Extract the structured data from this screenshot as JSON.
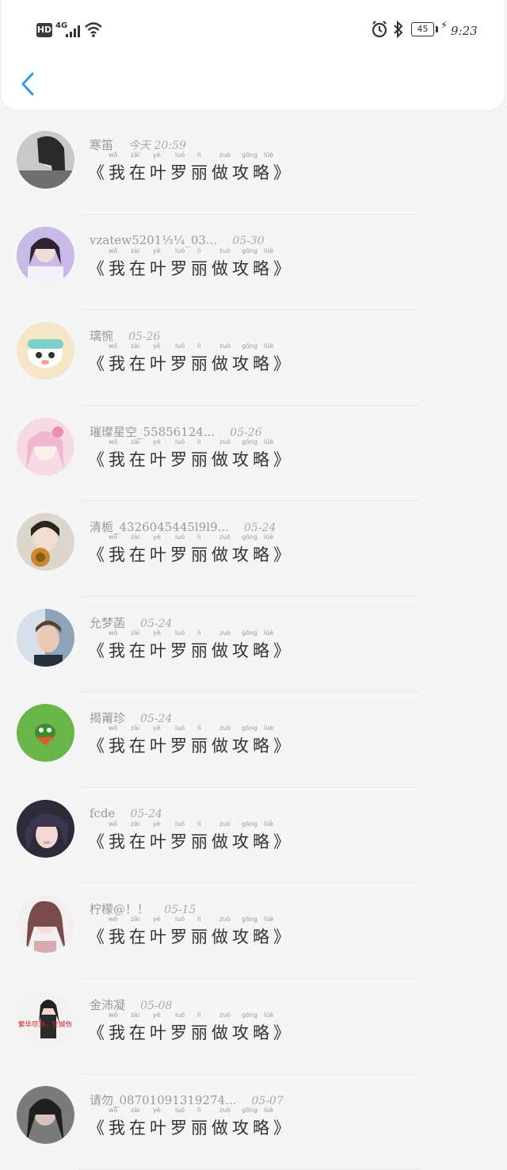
{
  "status_bar": {
    "hd": "HD",
    "network": "4G",
    "battery": "45",
    "time": "9:23",
    "icons": [
      "signal-icon",
      "wifi-icon",
      "alarm-icon",
      "bluetooth-icon",
      "battery-icon",
      "charging-icon"
    ]
  },
  "header": {
    "back_icon": "chevron-left-icon",
    "accent_color": "#2f9cf0"
  },
  "items": [
    {
      "name": "寒笛",
      "date": "今天 20:59",
      "title": "《我在叶罗丽做攻略》"
    },
    {
      "name": "vzatew5201⅓¼_03...",
      "date": "05-30",
      "title": "《我在叶罗丽做攻略》"
    },
    {
      "name": "璃惋",
      "date": "05-26",
      "title": "《我在叶罗丽做攻略》"
    },
    {
      "name": "璀璨星空_55856124...",
      "date": "05-26",
      "title": "《我在叶罗丽做攻略》"
    },
    {
      "name": "清栀_4326045445l9l9...",
      "date": "05-24",
      "title": "《我在叶罗丽做攻略》"
    },
    {
      "name": "允梦菡",
      "date": "05-24",
      "title": "《我在叶罗丽做攻略》"
    },
    {
      "name": "揭莆珍",
      "date": "05-24",
      "title": "《我在叶罗丽做攻略》"
    },
    {
      "name": "fcde",
      "date": "05-24",
      "title": "《我在叶罗丽做攻略》"
    },
    {
      "name": "柠檬@！！",
      "date": "05-15",
      "title": "《我在叶罗丽做攻略》"
    },
    {
      "name": "金沛凝",
      "date": "05-08",
      "title": "《我在叶罗丽做攻略》",
      "avatar_text": "繁华尽落、空城伤"
    },
    {
      "name": "请勿_08701091319274...",
      "date": "05-07",
      "title": "《我在叶罗丽做攻略》"
    }
  ],
  "pinyin": [
    "wǒ",
    "zài",
    "yè",
    "luó",
    "lì",
    "zuò",
    "gōng",
    "lüè"
  ]
}
